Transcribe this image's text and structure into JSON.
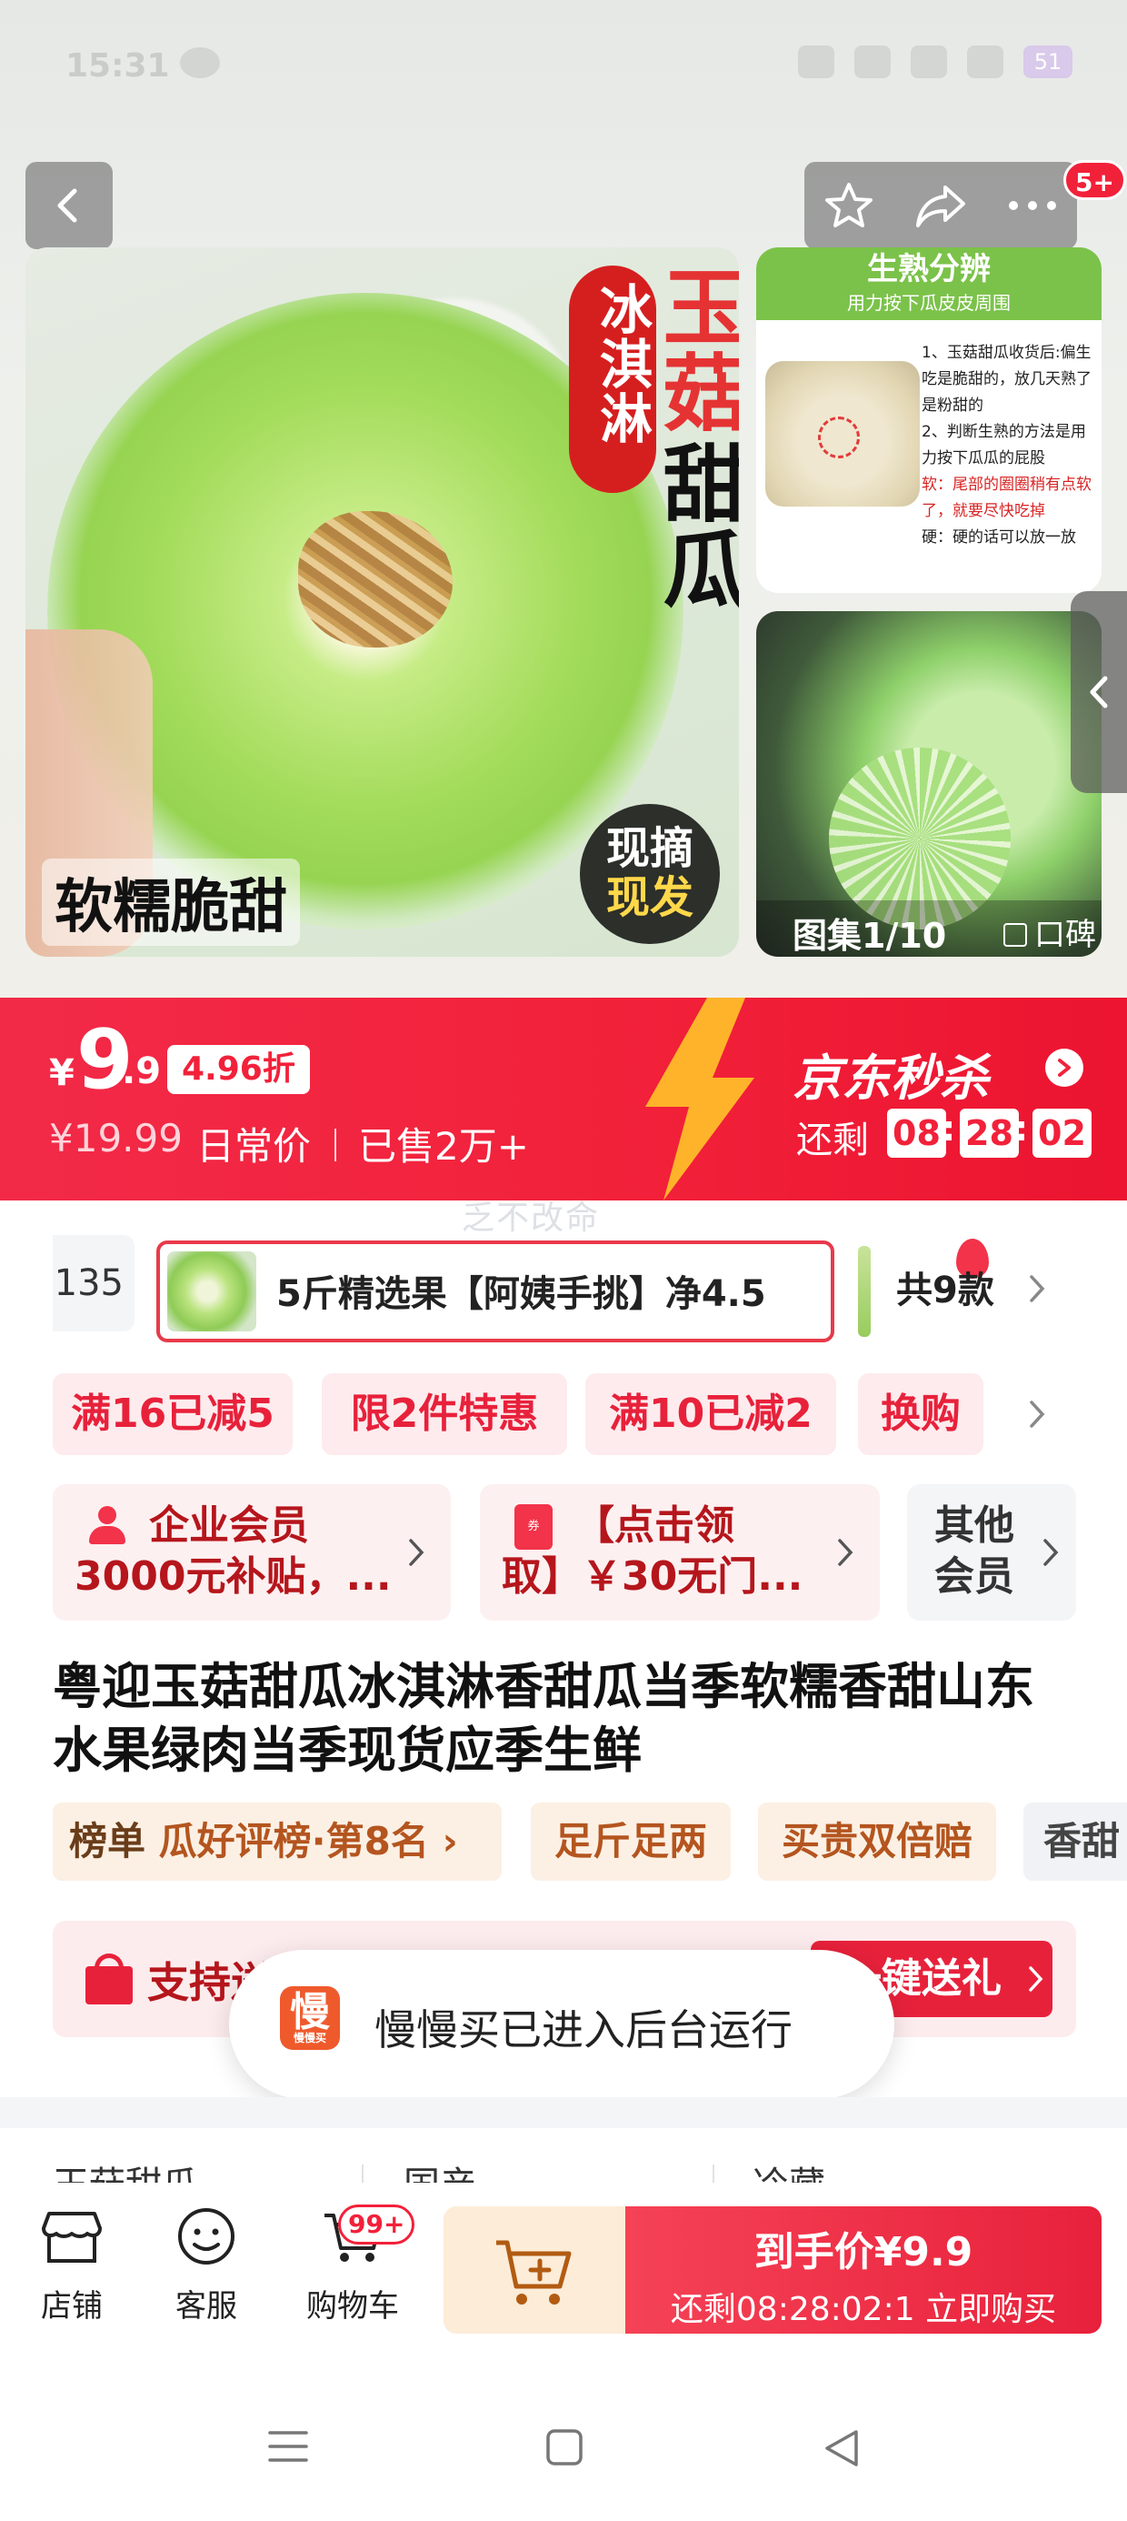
{
  "status_bar": {
    "time": "15:31",
    "battery": "51"
  },
  "toolbar": {
    "back_icon": "chevron-left-icon",
    "favorite_icon": "star-icon",
    "share_icon": "share-icon",
    "more_icon": "more-icon",
    "notification_badge": "5+"
  },
  "gallery": {
    "main_image": {
      "badge_vertical": "冰淇淋",
      "title_vertical_1": "玉菇",
      "title_vertical_2": "甜瓜",
      "slogan": "软糯脆甜",
      "fresh_line1": "现摘",
      "fresh_line2": "现发"
    },
    "ripeness_card": {
      "title": "生熟分辨",
      "subtitle": "用力按下瓜皮皮周围",
      "text_1": "1、玉菇甜瓜收货后:偏生吃是脆甜的，放几天熟了是粉甜的",
      "text_2": "2、判断生熟的方法是用力按下瓜瓜的屁股",
      "text_red": "软：尾部的圈圈稍有点软了，就要尽快吃掉",
      "text_3": "硬：硬的话可以放一放"
    },
    "counter": "图集1/10",
    "tag": "口碑"
  },
  "seckill": {
    "currency": "¥",
    "price_int": "9",
    "price_dec": ".9",
    "discount": "4.96折",
    "original_price": "¥19.99",
    "original_label": "日常价",
    "sold": "已售2万+",
    "brand": "京东秒杀",
    "remaining_label": "还剩",
    "hh": "08",
    "mm": "28",
    "ss": "02"
  },
  "watermark": "乏不改命",
  "variants": {
    "prev_partial": "135",
    "selected_label": "5斤精选果【阿姨手挑】净4.5",
    "count": "共9款"
  },
  "promotions": [
    "满16已减5",
    "限2件特惠",
    "满10已减2",
    "换购"
  ],
  "coupons": [
    {
      "line1": "企业会员",
      "line2": "3000元补贴，..."
    },
    {
      "line1": "【点击领",
      "line2": "取】￥30无门..."
    }
  ],
  "member_other": {
    "line1": "其他",
    "line2": "会员"
  },
  "product_title": "粤迎玉菇甜瓜冰淇淋香甜瓜当季软糯香甜山东水果绿肉当季现货应季生鲜",
  "tags": {
    "rank_key": "榜单",
    "rank_value": "瓜好评榜·第8名",
    "tag2": "足斤足两",
    "tag3": "买贵双倍赔",
    "tag4": "香甜"
  },
  "gift": {
    "text": "支持送",
    "button": "一键送礼"
  },
  "toast": {
    "logo": "慢",
    "logo_sub": "慢慢买",
    "text": "慢慢买已进入后台运行"
  },
  "specs": [
    "玉菇甜瓜",
    "国产",
    "冷藏"
  ],
  "bottom_bar": {
    "store": "店铺",
    "service": "客服",
    "cart": "购物车",
    "cart_badge": "99+",
    "buy_line1": "到手价¥9.9",
    "buy_line2": "还剩08:28:02:1 立即购买"
  }
}
